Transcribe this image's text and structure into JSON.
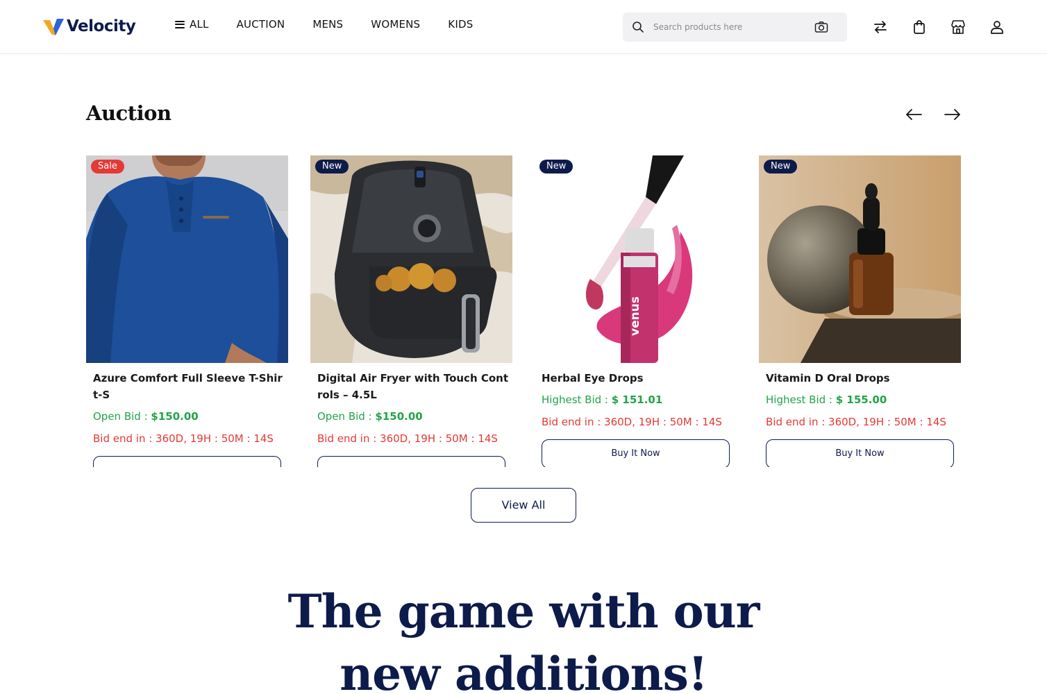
{
  "brand": {
    "name": "Velocity",
    "accent": "#0d1b4b",
    "logo_colors": [
      "#f5a623",
      "#2b63d9"
    ]
  },
  "nav": {
    "items": [
      {
        "label": "ALL"
      },
      {
        "label": "AUCTION"
      },
      {
        "label": "MENS"
      },
      {
        "label": "WOMENS"
      },
      {
        "label": "KIDS"
      }
    ]
  },
  "search": {
    "placeholder": "Search products here",
    "icon": "search-icon",
    "camera_icon": "camera-icon"
  },
  "header_icons": [
    "compare-icon",
    "bag-icon",
    "store-icon",
    "user-icon"
  ],
  "auction": {
    "title": "Auction",
    "cards": [
      {
        "badge": "Sale",
        "title": "Azure Comfort Full Sleeve T-Shirt-S",
        "bid_label": "Open Bid :",
        "bid_value": "$150.00",
        "end_text": "Bid end in : 360D, 19H : 50M : 14S",
        "button": "",
        "image": "blue-henley-shirt"
      },
      {
        "badge": "New",
        "title": "Digital Air Fryer with Touch Controls – 4.5L",
        "bid_label": "Open Bid :",
        "bid_value": "$150.00",
        "end_text": "Bid end in : 360D, 19H : 50M : 14S",
        "button": "",
        "image": "air-fryer"
      },
      {
        "badge": "New",
        "title": "Herbal Eye Drops",
        "bid_label": "Highest Bid :",
        "bid_value": "$ 151.01",
        "end_text": "Bid end in : 360D, 19H : 50M : 14S",
        "button": "Buy It Now",
        "image": "lip-gloss"
      },
      {
        "badge": "New",
        "title": "Vitamin D Oral Drops",
        "bid_label": "Highest Bid :",
        "bid_value": "$ 155.00",
        "end_text": "Bid end in : 360D, 19H : 50M : 14S",
        "button": "Buy It Now",
        "image": "dropper-bottle"
      }
    ],
    "view_all": "View All"
  },
  "headline": {
    "line1": "The game with our",
    "line2": "new additions!"
  }
}
